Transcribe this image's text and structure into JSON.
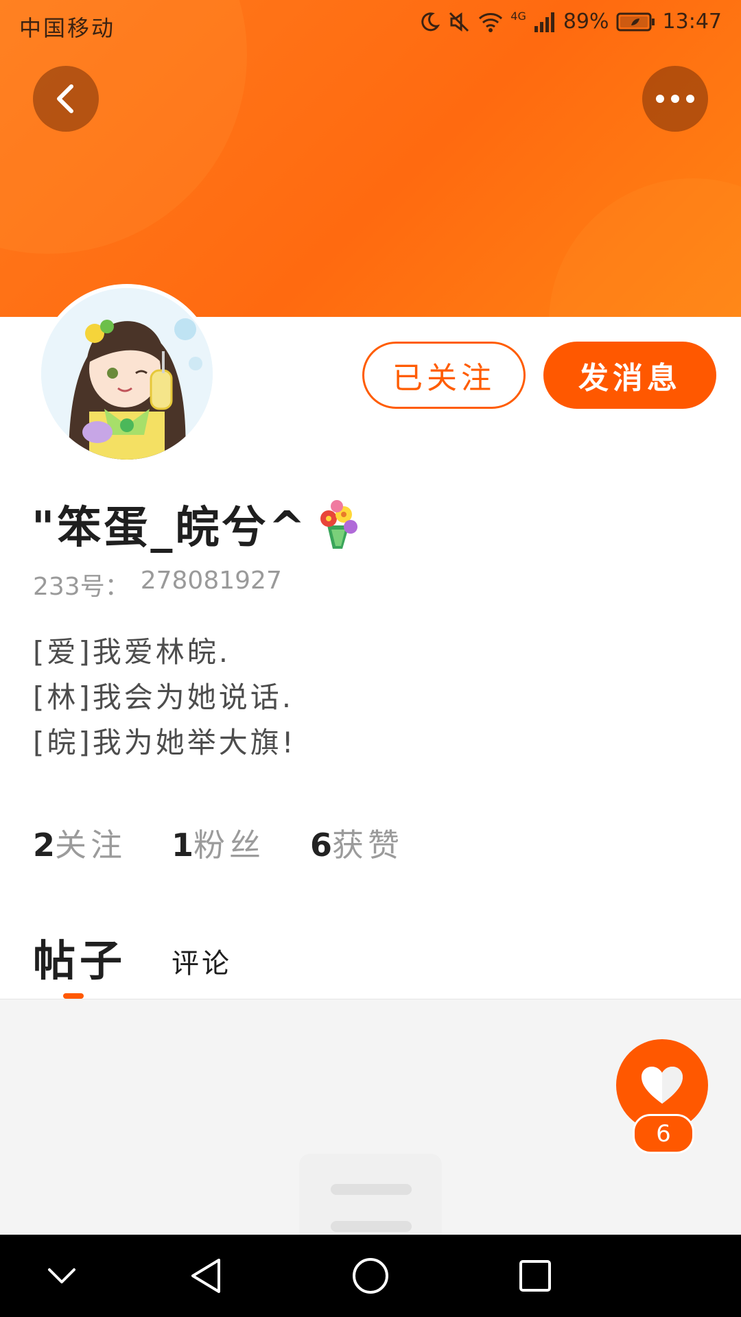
{
  "status_bar": {
    "carrier": "中国移动",
    "network": "4G",
    "battery": "89%",
    "time": "13:47"
  },
  "profile": {
    "display_name": "\"笨蛋_皖兮^",
    "name_emoji": "flower-bouquet",
    "id_label": "233号：",
    "id_value": "278081927",
    "bio": [
      "[爱]我爱林皖.",
      "[林]我会为她说话.",
      "[皖]我为她举大旗!"
    ]
  },
  "actions": {
    "follow_label": "已关注",
    "message_label": "发消息"
  },
  "stats": [
    {
      "num": "2",
      "label": "关注"
    },
    {
      "num": "1",
      "label": "粉丝"
    },
    {
      "num": "6",
      "label": "获赞"
    }
  ],
  "tabs": {
    "active": "帖子",
    "other": "评论"
  },
  "like": {
    "count": "6"
  },
  "colors": {
    "accent": "#ff5800",
    "header": "#ff7a1c"
  }
}
